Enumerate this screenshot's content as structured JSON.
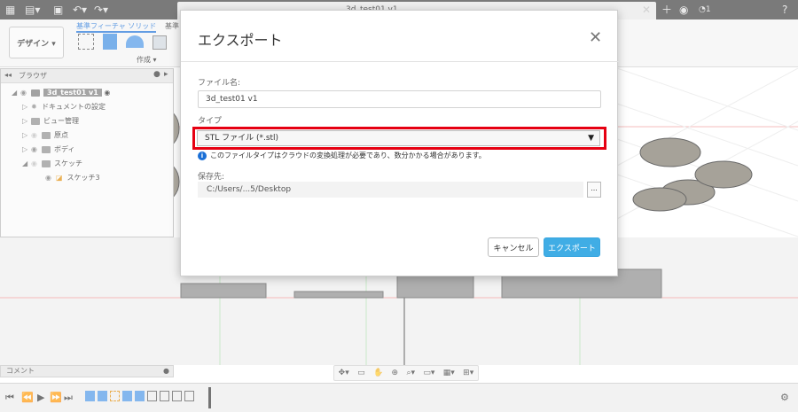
{
  "app": {
    "tab_title": "3d_test01 v1",
    "notification_count": "1"
  },
  "toolbar": {
    "design_label": "デザイン ▾",
    "tab_solid": "基準フィーチャ ソリッド",
    "tab_other": "基準フィ",
    "create_label": "作成 ▾"
  },
  "browser": {
    "title": "ブラウザ",
    "root_label": "3d_test01 v1",
    "items": [
      {
        "label": "ドキュメントの設定"
      },
      {
        "label": "ビュー管理"
      },
      {
        "label": "原点"
      },
      {
        "label": "ボディ"
      },
      {
        "label": "スケッチ"
      },
      {
        "label": "スケッチ3"
      }
    ]
  },
  "comment": {
    "label": "コメント"
  },
  "dialog": {
    "title": "エクスポート",
    "filename_label": "ファイル名:",
    "filename_value": "3d_test01 v1",
    "type_label": "タイプ",
    "type_value": "STL ファイル (*.stl)",
    "info_text": "このファイルタイプはクラウドの変換処理が必要であり、数分かかる場合があります。",
    "save_label": "保存先:",
    "save_path": "C:/Users/...5/Desktop",
    "browse_label": "...",
    "cancel_label": "キャンセル",
    "export_label": "エクスポート"
  },
  "colors": {
    "highlight": "#e60012",
    "primary_button": "#40ade5",
    "accent_blue": "#1a6fd6"
  }
}
